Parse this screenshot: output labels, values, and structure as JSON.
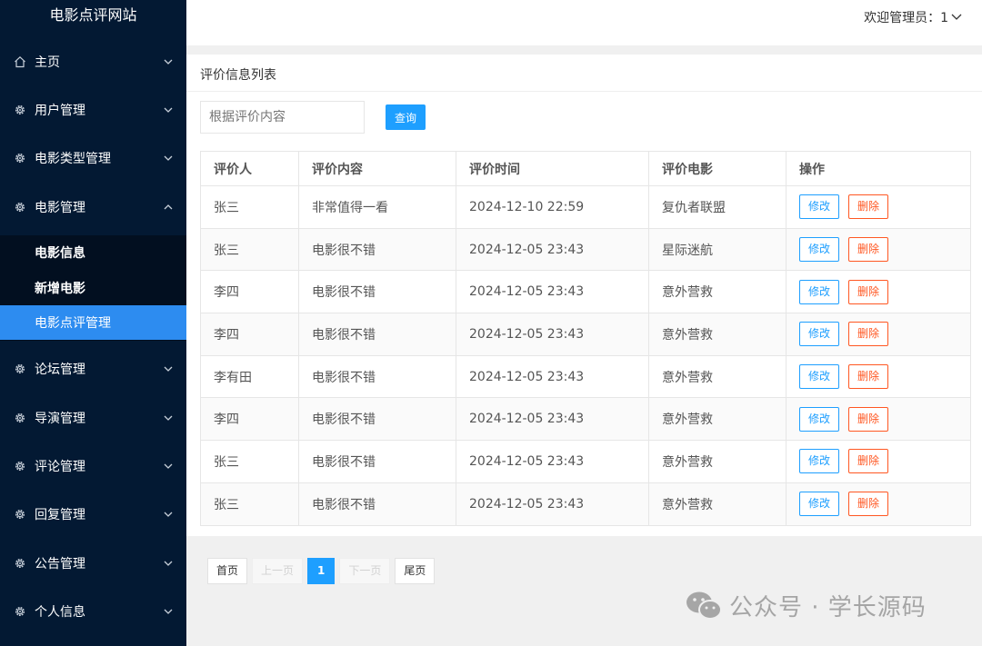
{
  "app": {
    "title": "电影点评网站"
  },
  "sidebar": {
    "items": [
      {
        "label": "主页",
        "icon": "home-icon"
      },
      {
        "label": "用户管理",
        "icon": "gear-icon"
      },
      {
        "label": "电影类型管理",
        "icon": "gear-icon"
      },
      {
        "label": "电影管理",
        "icon": "gear-icon",
        "expanded": true
      },
      {
        "label": "论坛管理",
        "icon": "gear-icon"
      },
      {
        "label": "导演管理",
        "icon": "gear-icon"
      },
      {
        "label": "评论管理",
        "icon": "gear-icon"
      },
      {
        "label": "回复管理",
        "icon": "gear-icon"
      },
      {
        "label": "公告管理",
        "icon": "gear-icon"
      },
      {
        "label": "个人信息",
        "icon": "gear-icon"
      }
    ],
    "sub_items": [
      {
        "label": "电影信息"
      },
      {
        "label": "新增电影"
      },
      {
        "label": "电影点评管理",
        "active": true
      }
    ]
  },
  "header": {
    "welcome": "欢迎管理员：1"
  },
  "main": {
    "title": "评价信息列表",
    "search": {
      "placeholder": "根据评价内容",
      "value": "",
      "button": "查询"
    },
    "table": {
      "columns": [
        "评价人",
        "评价内容",
        "评价时间",
        "评价电影",
        "操作"
      ],
      "edit_label": "修改",
      "delete_label": "删除",
      "rows": [
        {
          "reviewer": "张三",
          "content": "非常值得一看",
          "time": "2024-12-10 22:59",
          "movie": "复仇者联盟"
        },
        {
          "reviewer": "张三",
          "content": "电影很不错",
          "time": "2024-12-05 23:43",
          "movie": "星际迷航"
        },
        {
          "reviewer": "李四",
          "content": "电影很不错",
          "time": "2024-12-05 23:43",
          "movie": "意外营救"
        },
        {
          "reviewer": "李四",
          "content": "电影很不错",
          "time": "2024-12-05 23:43",
          "movie": "意外营救"
        },
        {
          "reviewer": "李有田",
          "content": "电影很不错",
          "time": "2024-12-05 23:43",
          "movie": "意外营救"
        },
        {
          "reviewer": "李四",
          "content": "电影很不错",
          "time": "2024-12-05 23:43",
          "movie": "意外营救"
        },
        {
          "reviewer": "张三",
          "content": "电影很不错",
          "time": "2024-12-05 23:43",
          "movie": "意外营救"
        },
        {
          "reviewer": "张三",
          "content": "电影很不错",
          "time": "2024-12-05 23:43",
          "movie": "意外营救"
        }
      ]
    },
    "pagination": {
      "first": "首页",
      "prev": "上一页",
      "current": "1",
      "next": "下一页",
      "last": "尾页"
    }
  },
  "watermark": {
    "text": "公众号 · 学长源码"
  },
  "colors": {
    "sidebar_bg": "#031933",
    "active_bg": "#2d8cf0",
    "primary": "#1e9fff",
    "danger": "#ff5722"
  }
}
